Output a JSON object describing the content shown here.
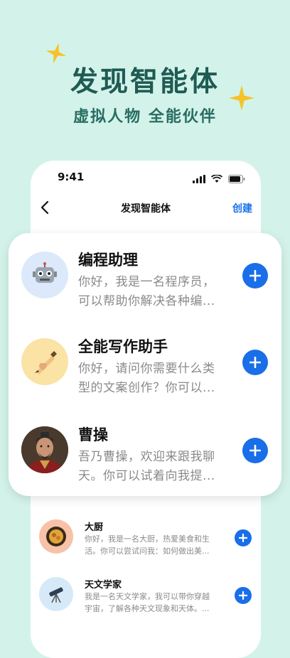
{
  "hero": {
    "title": "发现智能体",
    "subtitle": "虚拟人物 全能伙伴"
  },
  "status_bar": {
    "time": "9:41"
  },
  "nav": {
    "title": "发现智能体",
    "create_label": "创建"
  },
  "featured_agents": [
    {
      "name": "编程助理",
      "desc_line1": "你好，我是一名程序员，",
      "desc_line2": "可以帮助你解决各种编...",
      "icon": "robot-icon"
    },
    {
      "name": "全能写作助手",
      "desc_line1": "你好，请问你需要什么类",
      "desc_line2": "型的文案创作？你可以...",
      "icon": "writing-hand-icon"
    },
    {
      "name": "曹操",
      "desc_line1": "吾乃曹操，欢迎来跟我聊",
      "desc_line2": "天。你可以试着向我提...",
      "icon": "caocao-portrait"
    }
  ],
  "more_agents": [
    {
      "name": "大厨",
      "desc_line1": "你好，我是一名大厨，热爱美食和生",
      "desc_line2": "活。你可以尝试问我：如何做出美...",
      "icon": "dish-icon"
    },
    {
      "name": "天文学家",
      "desc_line1": "我是一名天文学家，我可以带你穿越",
      "desc_line2": "宇宙，了解各种天文现象和天体。...",
      "icon": "telescope-icon"
    }
  ],
  "colors": {
    "background": "#d3f3ea",
    "accent": "#1a6ee8",
    "title": "#1f5b53",
    "star": "#f6c22b"
  }
}
